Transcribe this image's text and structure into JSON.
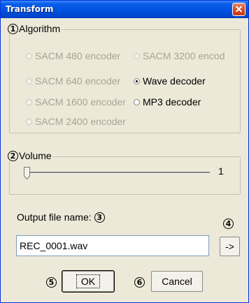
{
  "window": {
    "title": "Transform"
  },
  "algorithm": {
    "number": "①",
    "label": "Algorithm",
    "options": [
      {
        "label": "SACM 480 encoder",
        "enabled": false,
        "selected": false
      },
      {
        "label": "SACM 3200 encod",
        "enabled": false,
        "selected": false
      },
      {
        "label": "SACM 640 encoder",
        "enabled": false,
        "selected": false
      },
      {
        "label": "Wave decoder",
        "enabled": true,
        "selected": true
      },
      {
        "label": "SACM 1600 encoder",
        "enabled": false,
        "selected": false
      },
      {
        "label": "MP3 decoder",
        "enabled": true,
        "selected": false
      },
      {
        "label": "SACM 2400 encoder",
        "enabled": false,
        "selected": false
      }
    ]
  },
  "volume": {
    "number": "②",
    "label": "Volume",
    "value": "1",
    "min": 1,
    "max": 16
  },
  "output": {
    "label": "Output file name:",
    "number": "③",
    "value": "REC_0001.wav"
  },
  "browse": {
    "number": "④",
    "label": "->"
  },
  "ok": {
    "number": "⑤",
    "label": "OK"
  },
  "cancel": {
    "number": "⑥",
    "label": "Cancel"
  }
}
